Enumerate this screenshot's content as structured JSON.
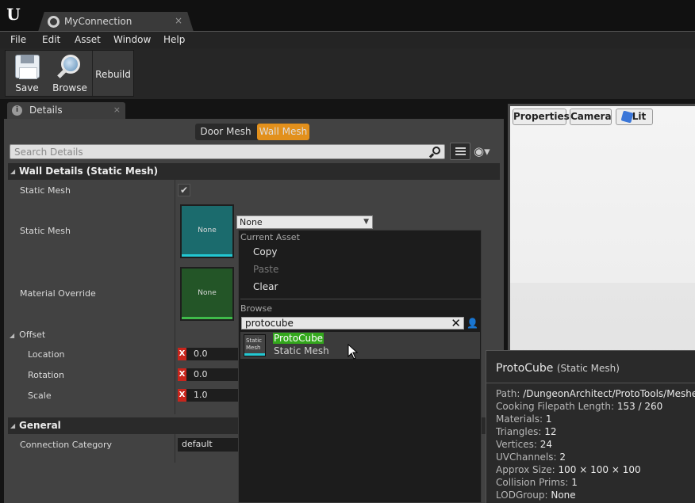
{
  "window": {
    "tab_title": "MyConnection",
    "tab_close": "×",
    "logo": "U"
  },
  "menu": [
    "File",
    "Edit",
    "Asset",
    "Window",
    "Help"
  ],
  "toolbar": {
    "save_label": "Save",
    "browse_label": "Browse",
    "rebuild_label": "Rebuild"
  },
  "details_tab": {
    "title": "Details",
    "close": "×"
  },
  "segment": {
    "options": [
      "Door Mesh",
      "Wall Mesh"
    ],
    "selected": "Wall Mesh"
  },
  "search": {
    "placeholder": "Search Details"
  },
  "wall_details": {
    "header": "Wall Details (Static Mesh)",
    "static_mesh_toggle_label": "Static Mesh",
    "static_mesh_checked": true,
    "static_mesh_label": "Static Mesh",
    "static_mesh_thumb_text": "None",
    "static_mesh_value": "None",
    "material_override_label": "Material Override",
    "material_thumb_text": "None",
    "offset_header": "Offset",
    "location_label": "Location",
    "location_x_axis": "X",
    "location_x": "0.0",
    "rotation_label": "Rotation",
    "rotation_x_axis": "X",
    "rotation_x": "0.0",
    "scale_label": "Scale",
    "scale_x_axis": "X",
    "scale_x": "1.0"
  },
  "general": {
    "header": "General",
    "connection_category_label": "Connection Category",
    "connection_category_value": "default"
  },
  "asset_picker": {
    "current_asset_header": "Current Asset",
    "copy": "Copy",
    "paste": "Paste",
    "clear": "Clear",
    "browse_header": "Browse",
    "search_text": "protocube",
    "result": {
      "thumb_text": "Static Mesh",
      "name": "ProtoCube",
      "type": "Static Mesh"
    }
  },
  "viewport": {
    "properties": "Properties",
    "camera": "Camera",
    "lit": "Lit"
  },
  "tooltip": {
    "name": "ProtoCube",
    "type": "(Static Mesh)",
    "rows": [
      {
        "label": "Path:",
        "value": "/DungeonArchitect/ProtoTools/Meshes"
      },
      {
        "label": "Cooking Filepath Length:",
        "value": "153 / 260"
      },
      {
        "label": "Materials:",
        "value": "1"
      },
      {
        "label": "Triangles:",
        "value": "12"
      },
      {
        "label": "Vertices:",
        "value": "24"
      },
      {
        "label": "UVChannels:",
        "value": "2"
      },
      {
        "label": "Approx Size:",
        "value": "100 × 100 × 100"
      },
      {
        "label": "Collision Prims:",
        "value": "1"
      },
      {
        "label": "LODGroup:",
        "value": "None"
      }
    ]
  },
  "colors": {
    "accent_orange": "#e2901c",
    "mesh_cyan": "#23c8d2",
    "material_green": "#3fbb4a",
    "match_highlight": "#33a71c",
    "axis_x": "#c8251c"
  }
}
